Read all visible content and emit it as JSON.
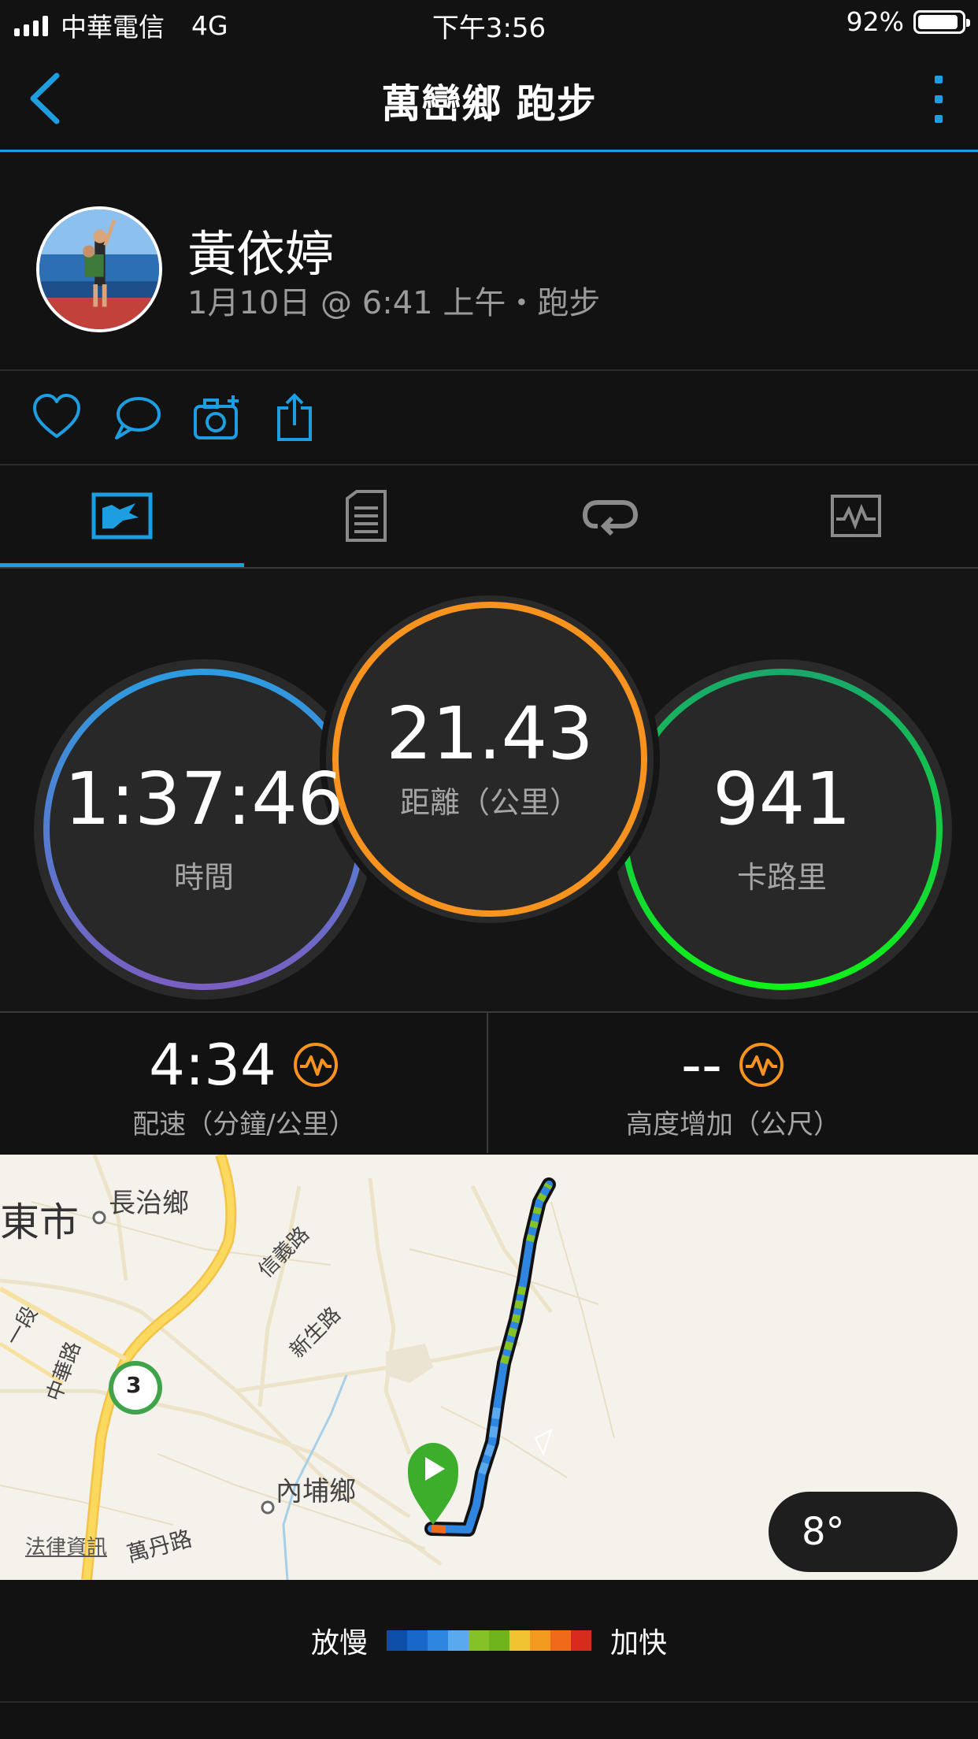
{
  "status_bar": {
    "carrier": "中華電信",
    "network": "4G",
    "time": "下午3:56",
    "battery": "92%",
    "battery_level": 0.92
  },
  "nav": {
    "title": "萬巒鄉 跑步"
  },
  "profile": {
    "name": "黃依婷",
    "meta": "1月10日 @ 6:41 上午・跑步"
  },
  "stats": {
    "time": {
      "value": "1:37:46",
      "label": "時間"
    },
    "distance": {
      "value": "21.43",
      "label": "距離（公里）"
    },
    "calories": {
      "value": "941",
      "label": "卡路里"
    }
  },
  "metrics": {
    "pace": {
      "value": "4:34",
      "label": "配速（分鐘/公里）"
    },
    "elevation": {
      "value": "--",
      "label": "高度增加（公尺）"
    }
  },
  "map": {
    "labels": {
      "city": "東市",
      "changzhi": "長治鄉",
      "xinyi": "信義路",
      "xinsheng": "新生路",
      "zhonghua": "中華路",
      "duan": "一段",
      "highway": "3",
      "neipu": "內埔鄉",
      "wandan": "萬丹路",
      "legal": "法律資訊"
    },
    "temperature": "8°"
  },
  "legend": {
    "slow": "放慢",
    "fast": "加快",
    "colors": [
      "#0b4fa8",
      "#1768c9",
      "#2f86e0",
      "#5aa9ef",
      "#84c226",
      "#6fb41c",
      "#f1c232",
      "#f39a21",
      "#ef6b1a",
      "#d92a1e"
    ]
  },
  "colors": {
    "accent": "#1d9ee0",
    "time_ring": "#5a7fd6",
    "distance_ring": "#f7931e",
    "calories_ring": "#14d21c"
  }
}
